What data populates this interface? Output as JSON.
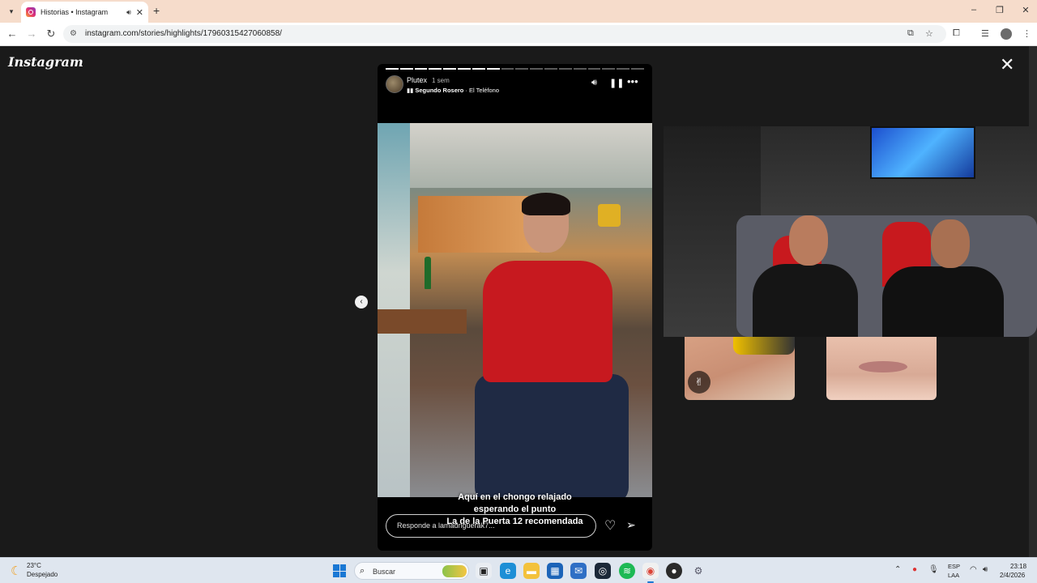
{
  "browser": {
    "tab_title": "Historias • Instagram",
    "url": "instagram.com/stories/highlights/17960315427060858/",
    "new_tab": "+",
    "window_controls": {
      "minimize": "–",
      "restore": "❐",
      "close": "✕"
    }
  },
  "instagram": {
    "logo": "Instagram",
    "close": "✕",
    "prev_arrow": "‹",
    "story": {
      "progress_total": 18,
      "progress_completed": 8,
      "username": "Plutex",
      "time_ago": "1 sem",
      "music_artist": "Segundo Rosero",
      "music_separator": " · ",
      "music_song": "El Teléfono",
      "caption_lines": [
        "Aquí en el chongo relajado",
        "esperando el punto",
        "La de la Puerta 12 recomendada"
      ],
      "reply_placeholder": "Responde a lamadriguerak7..."
    }
  },
  "taskbar": {
    "temperature": "23°C",
    "weather_desc": "Despejado",
    "search_label": "Buscar",
    "lang_line1": "ESP",
    "lang_line2": "LAA",
    "time": "23:18",
    "date": "2/4/2026"
  },
  "colors": {
    "tabstrip": "#f6dccb",
    "page_bg": "#1a1a1a",
    "taskbar": "#dfe6ef",
    "accent_blue": "#1a78d4"
  }
}
